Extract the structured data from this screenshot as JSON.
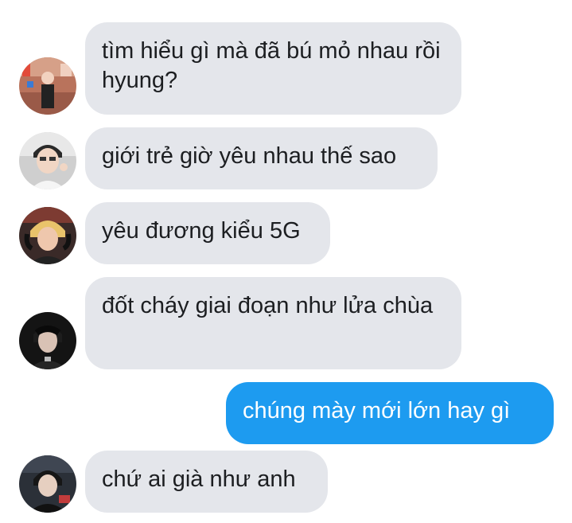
{
  "messages": [
    {
      "sender": "friend-1",
      "text": "tìm hiểu gì mà đã bú mỏ nhau rồi hyung?"
    },
    {
      "sender": "friend-2",
      "text": "giới trẻ giờ yêu nhau thế sao"
    },
    {
      "sender": "friend-3",
      "text": "yêu đương kiểu 5G"
    },
    {
      "sender": "friend-4",
      "text": "đốt cháy giai đoạn như lửa chùa"
    },
    {
      "sender": "me",
      "text": "chúng mày mới lớn hay gì"
    },
    {
      "sender": "friend-5",
      "text": "chứ ai già như anh"
    }
  ],
  "colors": {
    "incoming_bubble": "#e4e6eb",
    "outgoing_bubble": "#1d9bf0",
    "incoming_text": "#1c1e21",
    "outgoing_text": "#ffffff"
  }
}
